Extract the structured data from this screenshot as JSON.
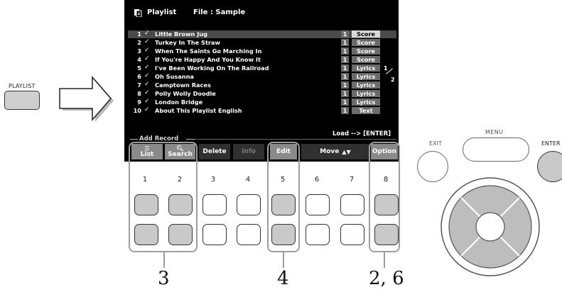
{
  "panel": {
    "playlist_label": "PLAYLIST",
    "menu_label": "MENU",
    "exit_label": "EXIT",
    "enter_label": "ENTER"
  },
  "screen": {
    "title": "Playlist",
    "file_label": "File : Sample",
    "records": [
      {
        "num": "1",
        "name": "Little Brown Jug",
        "one": "1",
        "type": "Score"
      },
      {
        "num": "2",
        "name": "Turkey In The Straw",
        "one": "1",
        "type": "Score"
      },
      {
        "num": "3",
        "name": "When The Saints Go Marching In",
        "one": "1",
        "type": "Score"
      },
      {
        "num": "4",
        "name": "If You're Happy And You Know It",
        "one": "1",
        "type": "Score"
      },
      {
        "num": "5",
        "name": "I've Been Working On The Railroad",
        "one": "1",
        "type": "Lyrics"
      },
      {
        "num": "6",
        "name": "Oh Susanna",
        "one": "1",
        "type": "Lyrics"
      },
      {
        "num": "7",
        "name": "Camptown Races",
        "one": "1",
        "type": "Lyrics"
      },
      {
        "num": "8",
        "name": "Polly Wolly Doodle",
        "one": "1",
        "type": "Lyrics"
      },
      {
        "num": "9",
        "name": "London Bridge",
        "one": "1",
        "type": "Lyrics"
      },
      {
        "num": "10",
        "name": "About This Playlist English",
        "one": "1",
        "type": "Text"
      }
    ],
    "pager_current": "1",
    "pager_total": "2",
    "load_hint": "Load --> [ENTER]",
    "add_record": "Add Record",
    "buttons": {
      "list": "List",
      "search": "Search",
      "delete": "Delete",
      "info": "Info",
      "edit": "Edit",
      "move": "Move",
      "option": "Option"
    }
  },
  "button_numbers": [
    "1",
    "2",
    "3",
    "4",
    "5",
    "6",
    "7",
    "8"
  ],
  "callouts": {
    "a": "3",
    "b": "4",
    "c": "2, 6"
  }
}
